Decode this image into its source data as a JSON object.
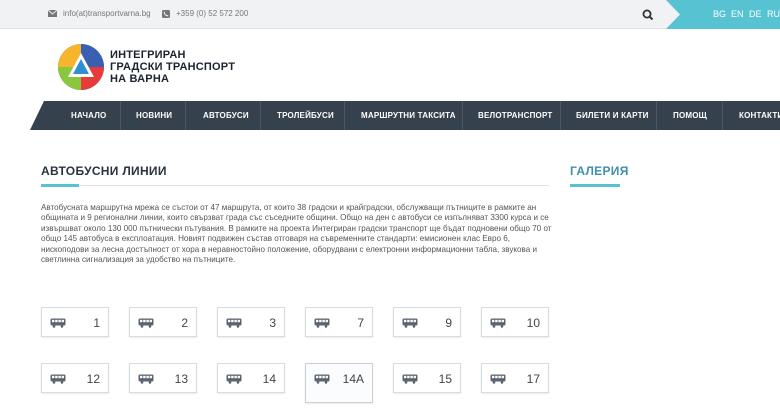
{
  "topbar": {
    "email": "info(at)transportvarna.bg",
    "phone": "+359 (0) 52 572 200",
    "languages": [
      "BG",
      "EN",
      "DE",
      "RU"
    ]
  },
  "brand": {
    "line1": "ИНТЕГРИРАН",
    "line2": "ГРАДСКИ ТРАНСПОРТ",
    "line3": "НА ВАРНА"
  },
  "nav": {
    "items": [
      "НАЧАЛО",
      "НОВИНИ",
      "АВТОБУСИ",
      "ТРОЛЕЙБУСИ",
      "МАРШРУТНИ ТАКСИТА",
      "ВЕЛОТРАНСПОРТ",
      "БИЛЕТИ И КАРТИ",
      "ПОМОЩ",
      "КОНТАКТИ"
    ]
  },
  "main": {
    "title": "АВТОБУСНИ ЛИНИИ",
    "description": "Автобусната маршрутна мрежа се състои от 47 маршрута, от които 38 градски и крайградски, обслужващи пътниците в рамките ан общината и 9 регионални линии, които свързват града със съседните общини. Общо на ден с автобуси се изпълняват 3300 курса и се извършват около 130 000 пътнически пътувания. В рамките на проекта Интегриран градски транспорт ще бъдат подновени общо 70 от общо 145 автобуса в експлоатация. Новият подвижен състав отговаря на съвременните стандарти: емисионен клас Евро 6, нископодови за лесна достъпност от хора в неравностойно положение, оборудвани с електронни информационни табла, звукова и светлинна сигнализация за удобство на пътниците.",
    "routes": [
      "1",
      "2",
      "3",
      "7",
      "9",
      "10",
      "12",
      "13",
      "14",
      "14А",
      "15",
      "17"
    ]
  },
  "sidebar": {
    "gallery_title": "ГАЛЕРИЯ"
  },
  "colors": {
    "accent": "#57c3d2",
    "nav_bg": "#36414e",
    "gallery_title": "#3d8fab"
  }
}
